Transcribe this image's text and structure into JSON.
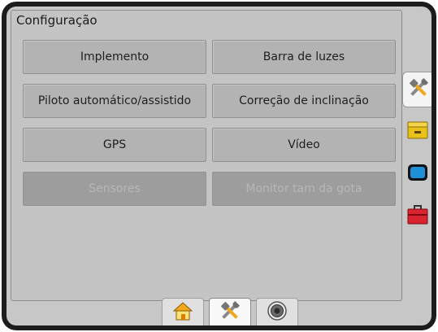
{
  "panel": {
    "title": "Configuração"
  },
  "buttons": {
    "implemento": "Implemento",
    "barra_luzes": "Barra de luzes",
    "piloto": "Piloto automático/assistido",
    "inclinacao": "Correção de inclinação",
    "gps": "GPS",
    "video": "Vídeo",
    "sensores": "Sensores",
    "monitor_gota": "Monitor tam da gota"
  },
  "side_tabs": [
    {
      "icon": "tools-icon",
      "active": true
    },
    {
      "icon": "storage-drawer-icon",
      "active": false
    },
    {
      "icon": "display-screen-icon",
      "active": false
    },
    {
      "icon": "toolbox-icon",
      "active": false
    }
  ],
  "bottom_tabs": [
    {
      "icon": "home-icon",
      "active": false
    },
    {
      "icon": "tools-icon",
      "active": true
    },
    {
      "icon": "camera-lens-icon",
      "active": false
    }
  ],
  "colors": {
    "screen_bg": "#c7c7c7",
    "button_bg": "#b3b3b3",
    "disabled_button_bg": "#9d9d9d",
    "toolbox_red": "#d9232e",
    "drawer_yellow": "#e8c21a",
    "screen_blue": "#1f8fd6"
  }
}
